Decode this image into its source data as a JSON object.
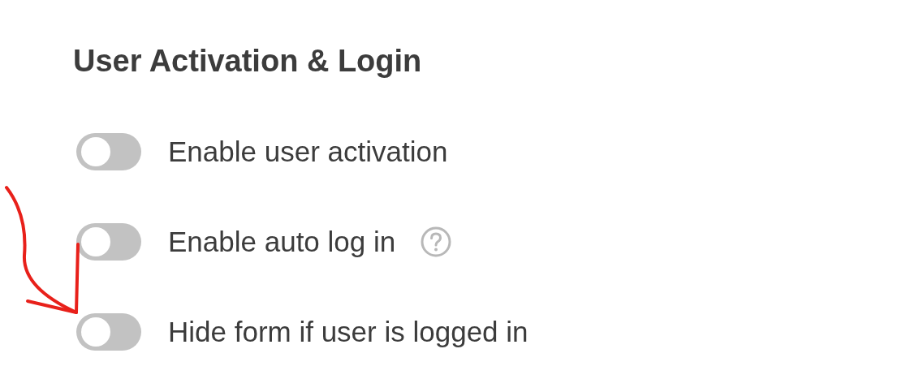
{
  "heading": "User Activation & Login",
  "settings": [
    {
      "label": "Enable user activation",
      "on": false,
      "help": false
    },
    {
      "label": "Enable auto log in",
      "on": false,
      "help": true
    },
    {
      "label": "Hide form if user is logged in",
      "on": false,
      "help": false
    }
  ]
}
